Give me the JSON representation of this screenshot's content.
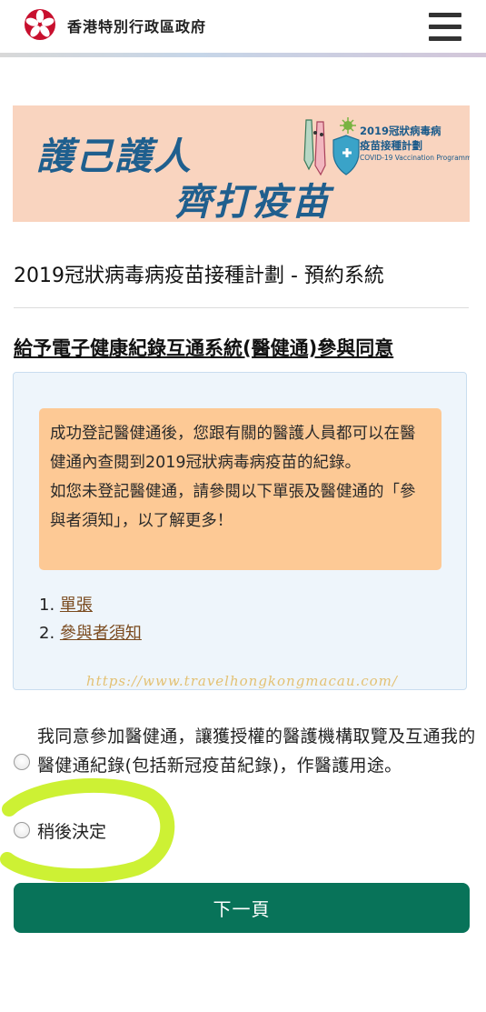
{
  "header": {
    "gov_name": "香港特別行政區政府"
  },
  "banner": {
    "slogan_line1": "護己護人",
    "slogan_line2": "齊打疫苗",
    "programme_zh_line1": "2019冠狀病毒病",
    "programme_zh_line2": "疫苗接種計劃",
    "programme_en": "COVID-19 Vaccination Programme"
  },
  "page": {
    "title": "2019冠狀病毒病疫苗接種計劃 - 預約系統",
    "section_title": "給予電子健康紀錄互通系統(醫健通)參與同意"
  },
  "notice": {
    "paragraph1": "成功登記醫健通後，您跟有關的醫護人員都可以在醫健通內查閱到2019冠狀病毒病疫苗的紀錄。",
    "paragraph2": "如您未登記醫健通，請參閱以下單張及醫健通的「參與者須知」，以了解更多！"
  },
  "documents": [
    {
      "num": "1.",
      "label": "單張"
    },
    {
      "num": "2.",
      "label": "參與者須知"
    }
  ],
  "watermark": "https://www.travelhongkongmacau.com/",
  "options": {
    "agree": "我同意參加醫健通，讓獲授權的醫護機構取覽及互通我的醫健通紀錄(包括新冠疫苗紀錄)，作醫護用途。",
    "later": "稍後決定"
  },
  "next_button": "下一頁",
  "colors": {
    "primary_button": "#087359",
    "notice_bg": "#fdc995",
    "info_box_bg": "#eef5fb",
    "banner_bg": "#f9d4bf",
    "highlight": "#c8ef1e"
  }
}
